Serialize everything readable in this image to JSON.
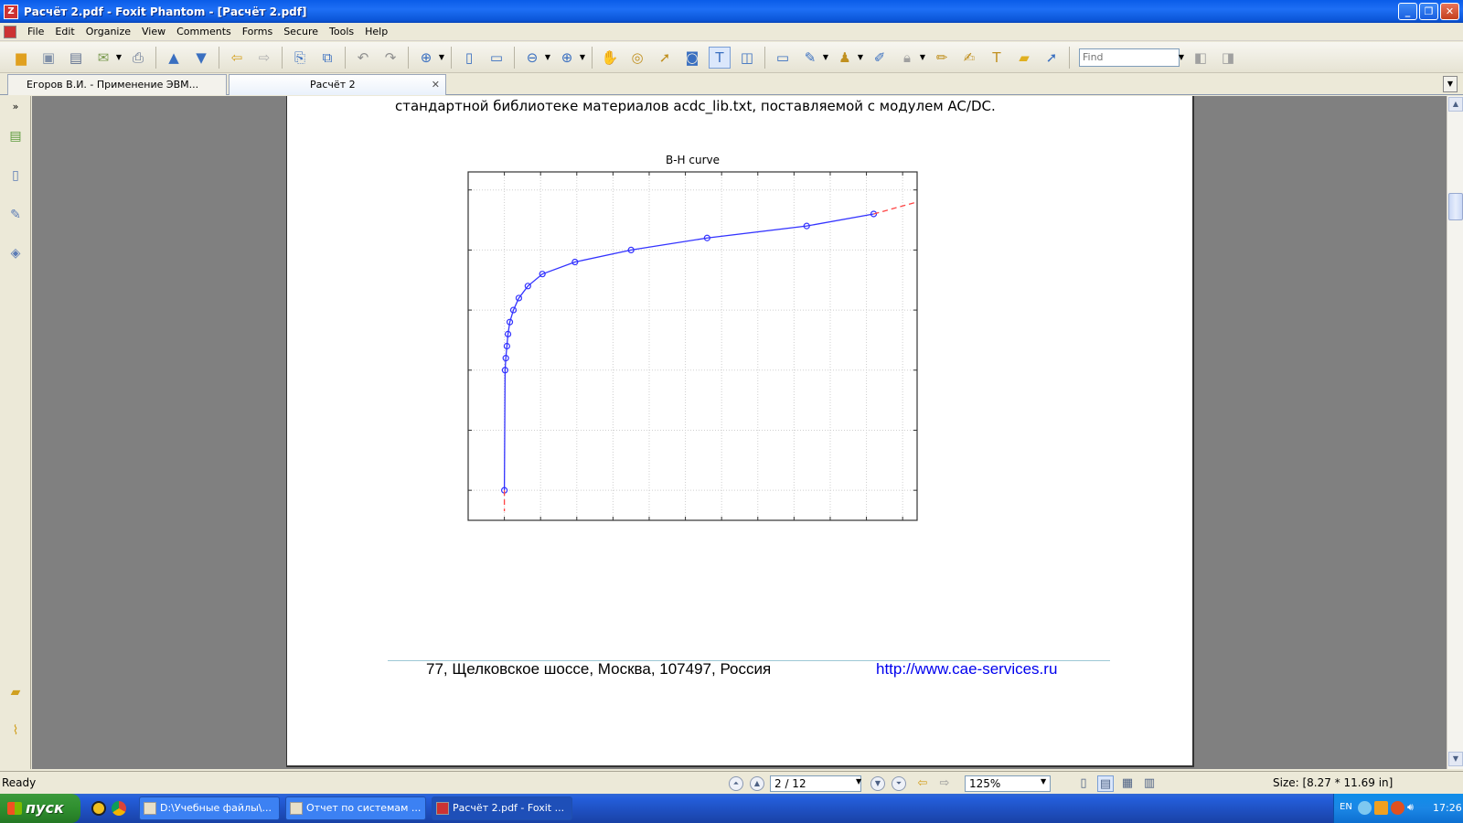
{
  "window": {
    "title": "Расчёт 2.pdf - Foxit Phantom - [Расчёт 2.pdf]",
    "app_icon_glyph": "Z"
  },
  "menu": [
    "File",
    "Edit",
    "Organize",
    "View",
    "Comments",
    "Forms",
    "Secure",
    "Tools",
    "Help"
  ],
  "toolbar": {
    "find_placeholder": "Find"
  },
  "tabs": [
    {
      "label": "Егоров В.И. - Применение ЭВМ...",
      "active": false
    },
    {
      "label": "Расчёт 2",
      "active": true
    }
  ],
  "document": {
    "top_text": "стандартной библиотеке материалов acdc_lib.txt, поставляемой с модулем AC/DC.",
    "footer_address": "77, Щелковское шоссе, Москва, 107497, Россия",
    "footer_url": "http://www.cae-services.ru"
  },
  "chart_data": {
    "type": "line",
    "title": "B-H curve",
    "xlabel": "",
    "ylabel": "",
    "xlim": [
      -1,
      11.4
    ],
    "ylim": [
      -0.5,
      5.3
    ],
    "grid": true,
    "tick_labels_visible": false,
    "series": [
      {
        "color": "#3333ff",
        "marker": "circle",
        "x": [
          0,
          0.02,
          0.04,
          0.07,
          0.1,
          0.15,
          0.25,
          0.4,
          0.65,
          1.05,
          1.95,
          3.5,
          5.6,
          8.35,
          10.2
        ],
        "y": [
          0,
          2.0,
          2.2,
          2.4,
          2.6,
          2.8,
          3.0,
          3.2,
          3.4,
          3.6,
          3.8,
          4.0,
          4.2,
          4.4,
          4.6
        ]
      },
      {
        "color": "#ff4444",
        "dashed": true,
        "x": [
          10.2,
          11.4
        ],
        "y": [
          4.6,
          4.8
        ]
      },
      {
        "color": "#ff4444",
        "dashed": true,
        "x": [
          0,
          0
        ],
        "y": [
          0,
          -0.35
        ]
      }
    ]
  },
  "status": {
    "ready": "Ready",
    "page": "2 / 12",
    "zoom": "125%",
    "size": "Size: [8.27 * 11.69 in]"
  },
  "taskbar": {
    "start_label": "пуск",
    "tasks": [
      {
        "label": "D:\\Учебные файлы\\...",
        "active": false
      },
      {
        "label": "Отчет по системам ...",
        "active": false
      },
      {
        "label": "Расчёт 2.pdf - Foxit ...",
        "active": true
      }
    ],
    "lang": "EN",
    "clock": "17:26"
  }
}
